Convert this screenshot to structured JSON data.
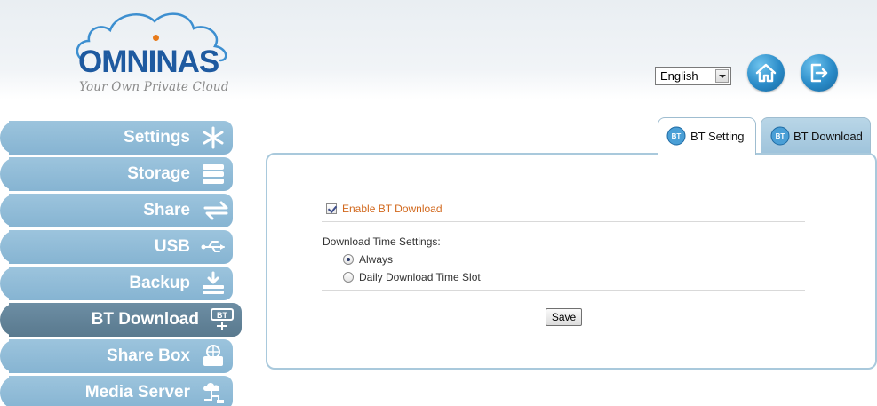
{
  "brand": {
    "name": "OMNINAS",
    "tagline": "Your Own Private Cloud"
  },
  "header": {
    "language": {
      "selected": "English"
    },
    "buttons": {
      "home": "home-icon",
      "logout": "logout-icon"
    }
  },
  "sidebar": {
    "items": [
      {
        "label": "Settings",
        "icon": "gear-snowflake-icon",
        "active": false
      },
      {
        "label": "Storage",
        "icon": "storage-stack-icon",
        "active": false
      },
      {
        "label": "Share",
        "icon": "share-arrows-icon",
        "active": false
      },
      {
        "label": "USB",
        "icon": "usb-icon",
        "active": false
      },
      {
        "label": "Backup",
        "icon": "backup-download-icon",
        "active": false
      },
      {
        "label": "BT Download",
        "icon": "bt-download-icon",
        "active": true
      },
      {
        "label": "Share Box",
        "icon": "share-box-icon",
        "active": false
      },
      {
        "label": "Media Server",
        "icon": "media-server-icon",
        "active": false
      }
    ]
  },
  "tabs": [
    {
      "label": "BT Setting",
      "active": true
    },
    {
      "label": "BT Download",
      "active": false
    }
  ],
  "form": {
    "enable_label": "Enable BT Download",
    "enable_checked": true,
    "time_title": "Download Time Settings:",
    "options": [
      {
        "label": "Always",
        "selected": true
      },
      {
        "label": "Daily Download Time Slot",
        "selected": false
      }
    ],
    "save_label": "Save"
  },
  "colors": {
    "accent_blue": "#1a5fa8",
    "sidebar_bg": "#8fbad6",
    "sidebar_active": "#627f94",
    "enable_text": "#d2691e"
  }
}
